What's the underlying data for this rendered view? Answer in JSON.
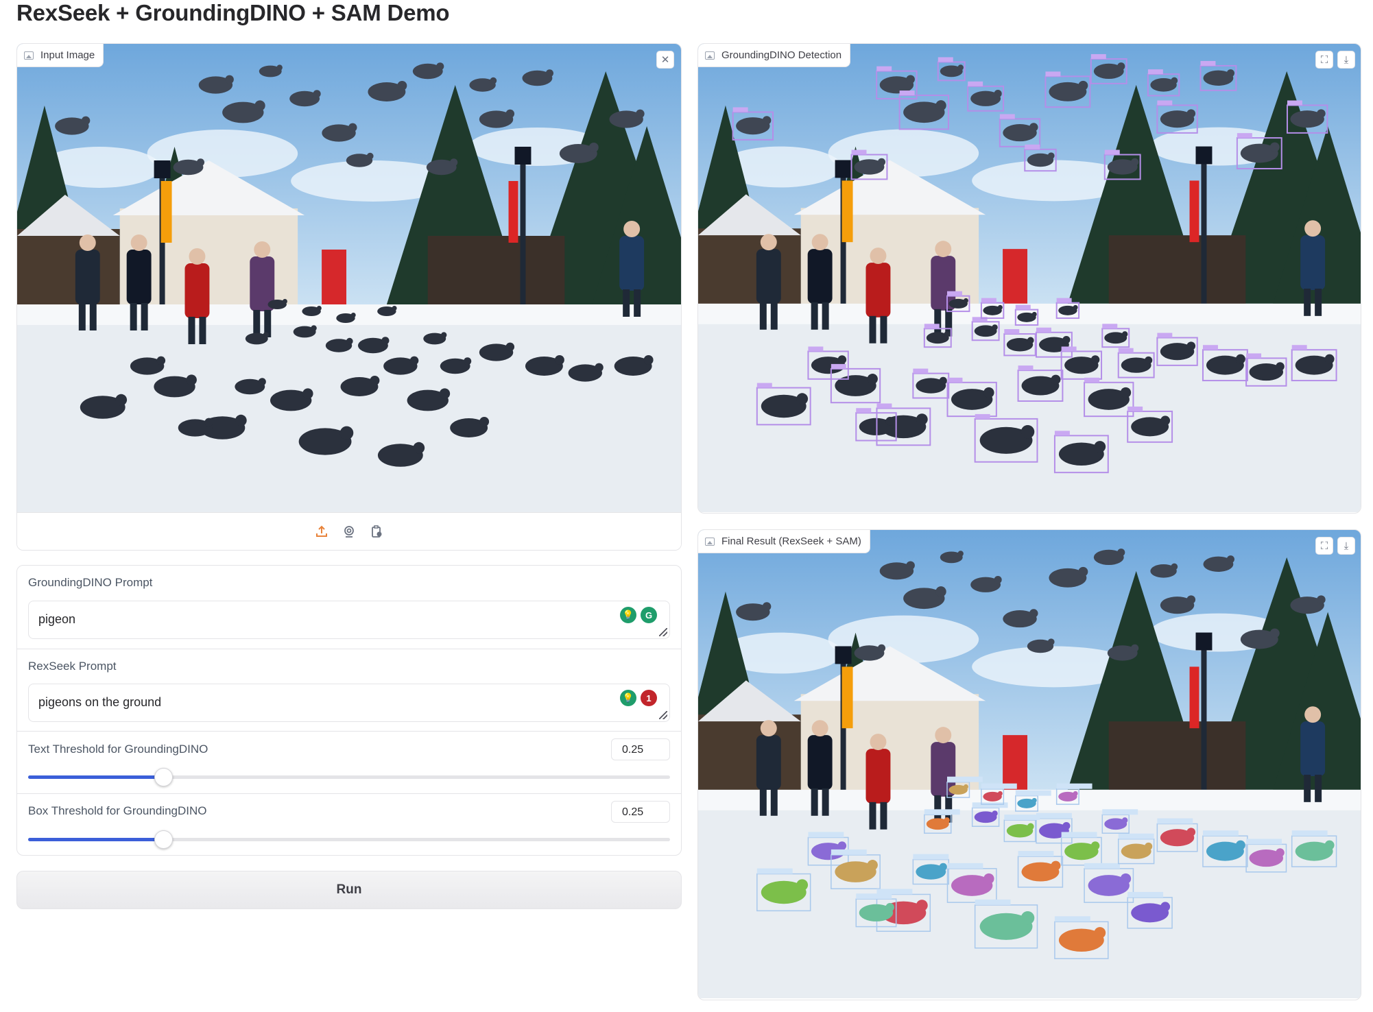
{
  "page_title": "RexSeek + GroundingDINO + SAM Demo",
  "input_panel": {
    "label": "Input Image",
    "clear_icon": "close-icon",
    "tools": [
      "upload-icon",
      "webcam-icon",
      "clipboard-icon"
    ]
  },
  "detection_panel": {
    "label": "GroundingDINO Detection",
    "box_label": "pigeon",
    "buttons": [
      "fullscreen-icon",
      "download-icon"
    ]
  },
  "result_panel": {
    "label": "Final Result (RexSeek + SAM)",
    "box_label": "pigeons on the ground",
    "buttons": [
      "fullscreen-icon",
      "download-icon"
    ]
  },
  "form": {
    "gd_prompt_label": "GroundingDINO Prompt",
    "gd_prompt_value": "pigeon",
    "rex_prompt_label": "RexSeek Prompt",
    "rex_prompt_value": "pigeons on the ground",
    "grammar_badge_count": "1",
    "text_threshold_label": "Text Threshold for GroundingDINO",
    "text_threshold_value": "0.25",
    "text_threshold_fraction": 0.25,
    "box_threshold_label": "Box Threshold for GroundingDINO",
    "box_threshold_value": "0.25",
    "box_threshold_fraction": 0.25
  },
  "run_label": "Run",
  "colors": {
    "accent": "#3b5fd9",
    "detection_box": "#b48ee8",
    "result_box": "#a8c8ec",
    "upload_icon": "#e8833a",
    "grammar_green": "#1f9d6b",
    "grammar_red": "#c2252b"
  }
}
